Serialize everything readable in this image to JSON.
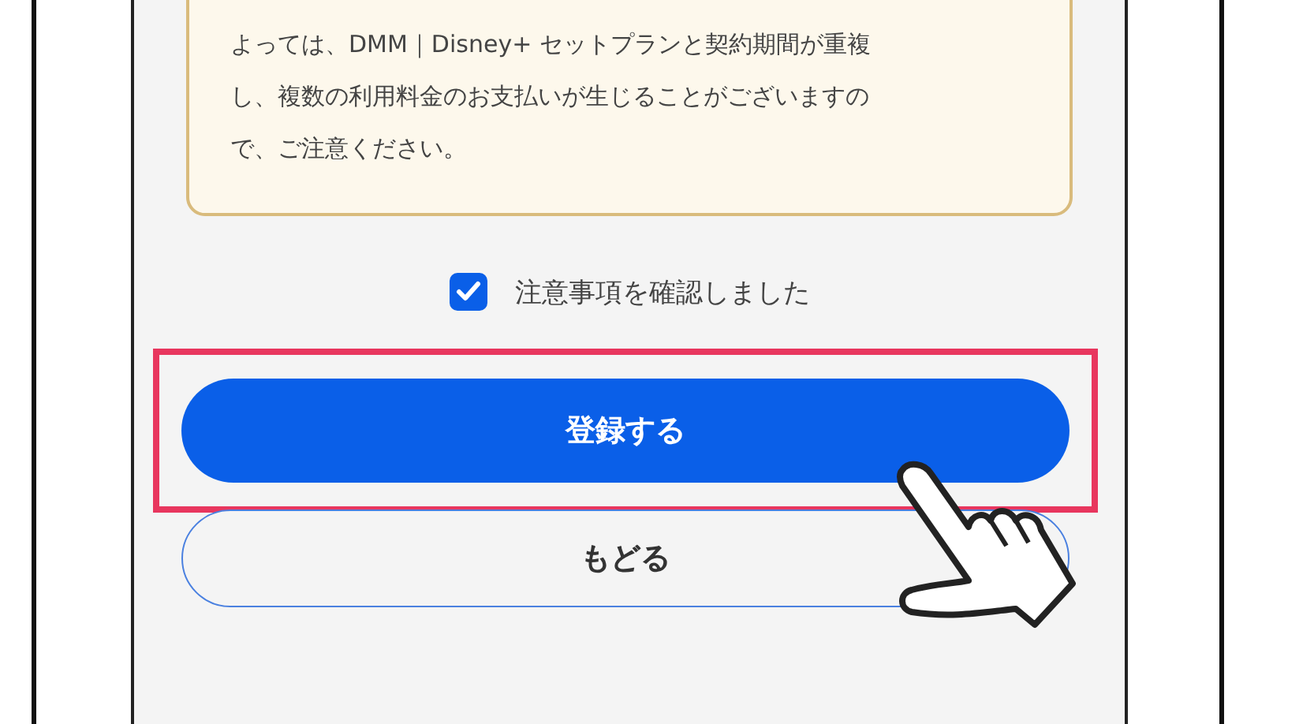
{
  "notice": {
    "text": "よっては、DMM｜Disney+ セットプランと契約期間が重複し、複数の利用料金のお支払いが生じることがございますので、ご注意ください。"
  },
  "confirm": {
    "label": "注意事項を確認しました",
    "checked": true
  },
  "buttons": [
    {
      "kind": "primary",
      "label": "登録する",
      "highlighted": true
    },
    {
      "kind": "secondary",
      "label": "もどる",
      "highlighted": false
    }
  ]
}
